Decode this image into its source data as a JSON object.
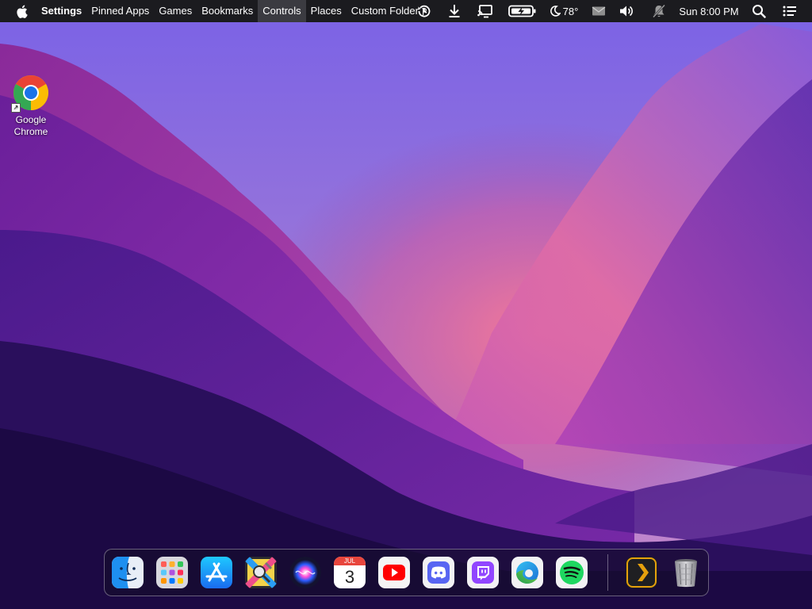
{
  "menubar": {
    "apple_icon": "apple-logo-icon",
    "items": [
      "Settings",
      "Pinned Apps",
      "Games",
      "Bookmarks",
      "Controls",
      "Places",
      "Custom Folder"
    ],
    "active_item": "Controls",
    "custom_folder_icon": "scroll-curl-icon",
    "weather": "78°",
    "clock": "Sun 8:00 PM",
    "tray_icons": [
      "history-icon",
      "download-icon",
      "display-cast-icon",
      "battery-charging-icon",
      "moon-weather-icon",
      "mail-icon",
      "volume-icon",
      "notifications-off-icon",
      "search-icon",
      "list-menu-icon"
    ]
  },
  "desktop": {
    "icons": [
      {
        "label_line1": "Google",
        "label_line2": "Chrome",
        "icon": "chrome-icon"
      }
    ]
  },
  "calendar": {
    "month": "JUL",
    "day": "3"
  },
  "dock": {
    "apps": [
      "finder-icon",
      "launchpad-icon",
      "app-store-icon",
      "system-tools-icon",
      "siri-icon",
      "calendar-icon",
      "youtube-icon",
      "discord-icon",
      "twitch-icon",
      "edge-icon",
      "spotify-icon",
      "plex-icon",
      "trash-icon"
    ]
  },
  "colors": {
    "menubar_bg": "#1b1b1f",
    "active_menu_bg": "#3b3b41",
    "wallpaper_top": "#7b5fe0",
    "wallpaper_glow": "#f0709a"
  }
}
